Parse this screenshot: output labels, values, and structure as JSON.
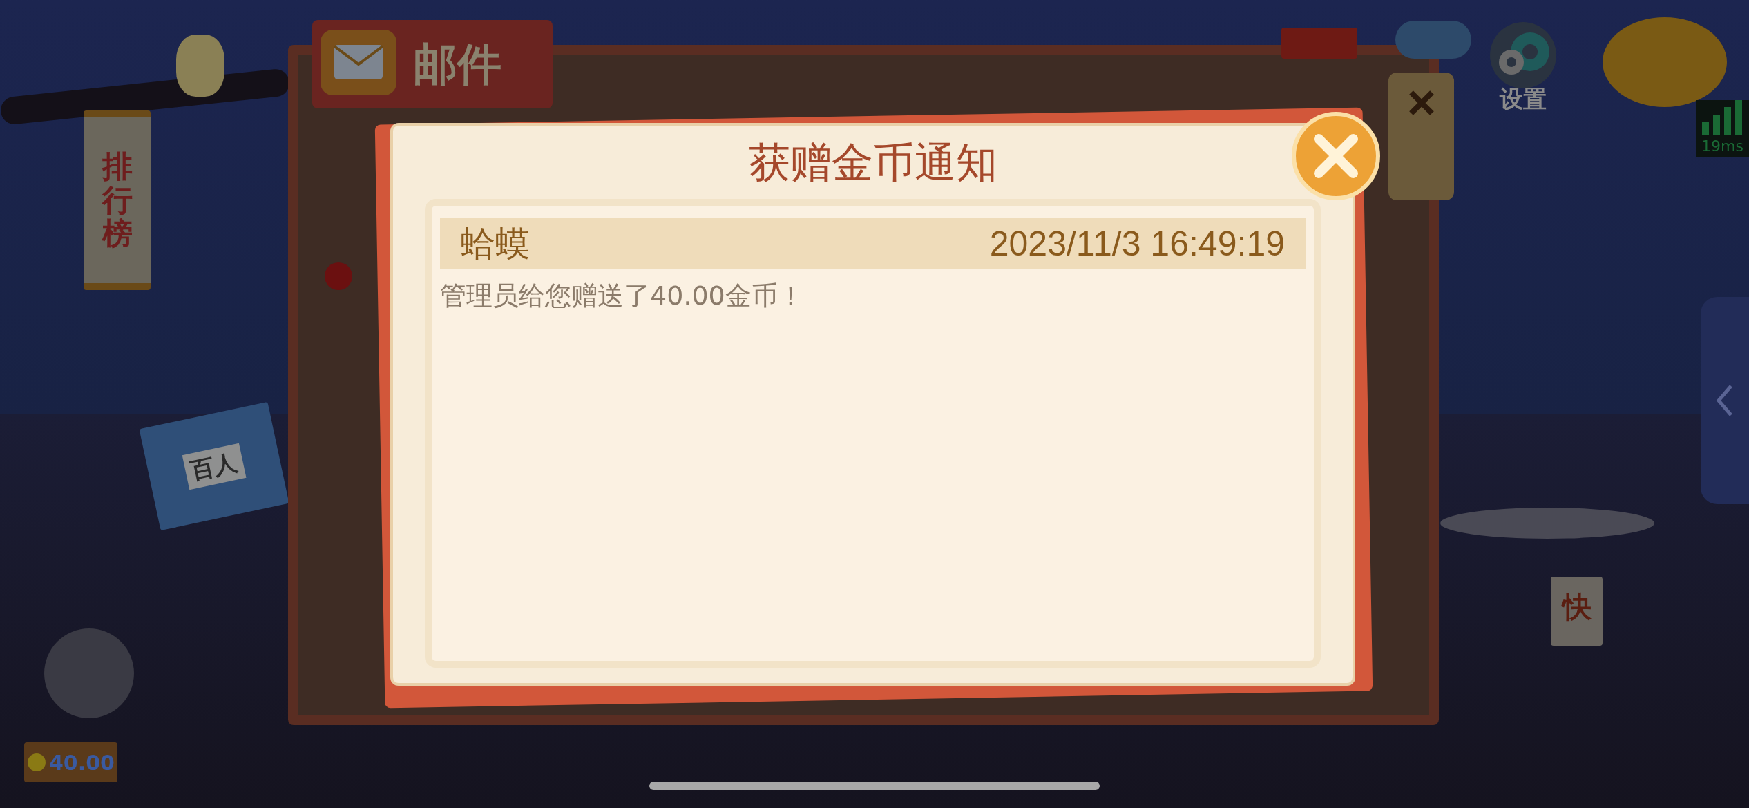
{
  "scene": {
    "mail_tab": "邮件",
    "leaderboard_sign": "排行榜",
    "book_label": "百人",
    "settings_label": "设置",
    "latency": "19ms",
    "balance": "40.00",
    "quick_sign": "快"
  },
  "dialog": {
    "title": "获赠金币通知",
    "sender": "蛤蟆",
    "time": "2023/11/3 16:49:19",
    "body": "管理员给您赠送了40.00金币！"
  }
}
